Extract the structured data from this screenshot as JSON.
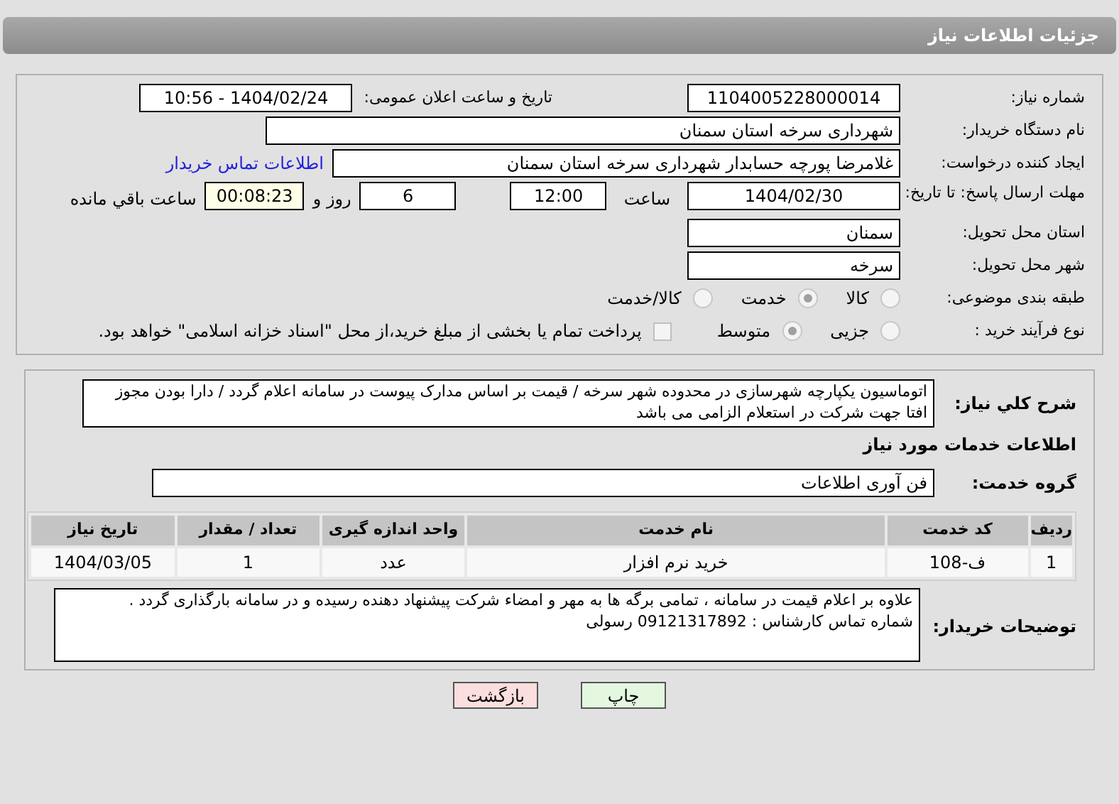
{
  "header": {
    "title": "جزئیات اطلاعات نیاز"
  },
  "need_number": {
    "label": "شماره نیاز:",
    "value": "1104005228000014"
  },
  "announce": {
    "label": "تاریخ و ساعت اعلان عمومی:",
    "value": "1404/02/24 - 10:56"
  },
  "buyer_org": {
    "label": "نام دستگاه خریدار:",
    "value": "شهرداری سرخه استان سمنان"
  },
  "creator": {
    "label": "ایجاد کننده درخواست:",
    "value": "غلامرضا پورچه حسابدار شهرداری سرخه استان سمنان",
    "link": "اطلاعات تماس خریدار"
  },
  "deadline": {
    "label": "مهلت ارسال پاسخ: تا تاریخ:",
    "date": "1404/02/30",
    "time_label": "ساعت",
    "time": "12:00",
    "days": "6",
    "days_label": "روز و",
    "remaining": "00:08:23",
    "remaining_label": "ساعت باقي مانده"
  },
  "province": {
    "label": "استان محل تحویل:",
    "value": "سمنان"
  },
  "city": {
    "label": "شهر محل تحویل:",
    "value": "سرخه"
  },
  "category": {
    "label": "طبقه بندی موضوعی:",
    "options": [
      {
        "label": "کالا",
        "selected": false
      },
      {
        "label": "خدمت",
        "selected": true
      },
      {
        "label": "کالا/خدمت",
        "selected": false
      }
    ]
  },
  "process": {
    "label": "نوع فرآیند خرید :",
    "options": [
      {
        "label": "جزیی",
        "selected": false
      },
      {
        "label": "متوسط",
        "selected": true
      }
    ],
    "payment": {
      "checked": false,
      "text": "پرداخت تمام یا بخشی از مبلغ خرید،از محل \"اسناد خزانه اسلامی\" خواهد بود."
    }
  },
  "description": {
    "label": "شرح کلي نیاز:",
    "value": "اتوماسیون یکپارچه شهرسازی در محدوده شهر سرخه / قیمت بر اساس مدارک پیوست در سامانه اعلام گردد / دارا بودن مجوز افتا جهت شرکت در استعلام الزامی می باشد"
  },
  "services_heading": "اطلاعات خدمات مورد نیاز",
  "service_group": {
    "label": "گروه خدمت:",
    "value": "فن آوری اطلاعات"
  },
  "table": {
    "columns": [
      "ردیف",
      "کد خدمت",
      "نام خدمت",
      "واحد اندازه گیری",
      "تعداد / مقدار",
      "تاریخ نیاز"
    ],
    "rows": [
      [
        "1",
        "ف-108",
        "خرید نرم افزار",
        "عدد",
        "1",
        "1404/03/05"
      ]
    ]
  },
  "buyer_notes": {
    "label": "توضیحات خریدار:",
    "value": "علاوه بر اعلام قیمت در سامانه ، تمامی برگه ها به مهر و امضاء شرکت پیشنهاد دهنده رسیده و در سامانه بارگذاری گردد .\nشماره تماس کارشناس : 09121317892 رسولی"
  },
  "buttons": [
    {
      "kind": "print",
      "label": "چاپ"
    },
    {
      "kind": "back",
      "label": "بازگشت"
    }
  ]
}
